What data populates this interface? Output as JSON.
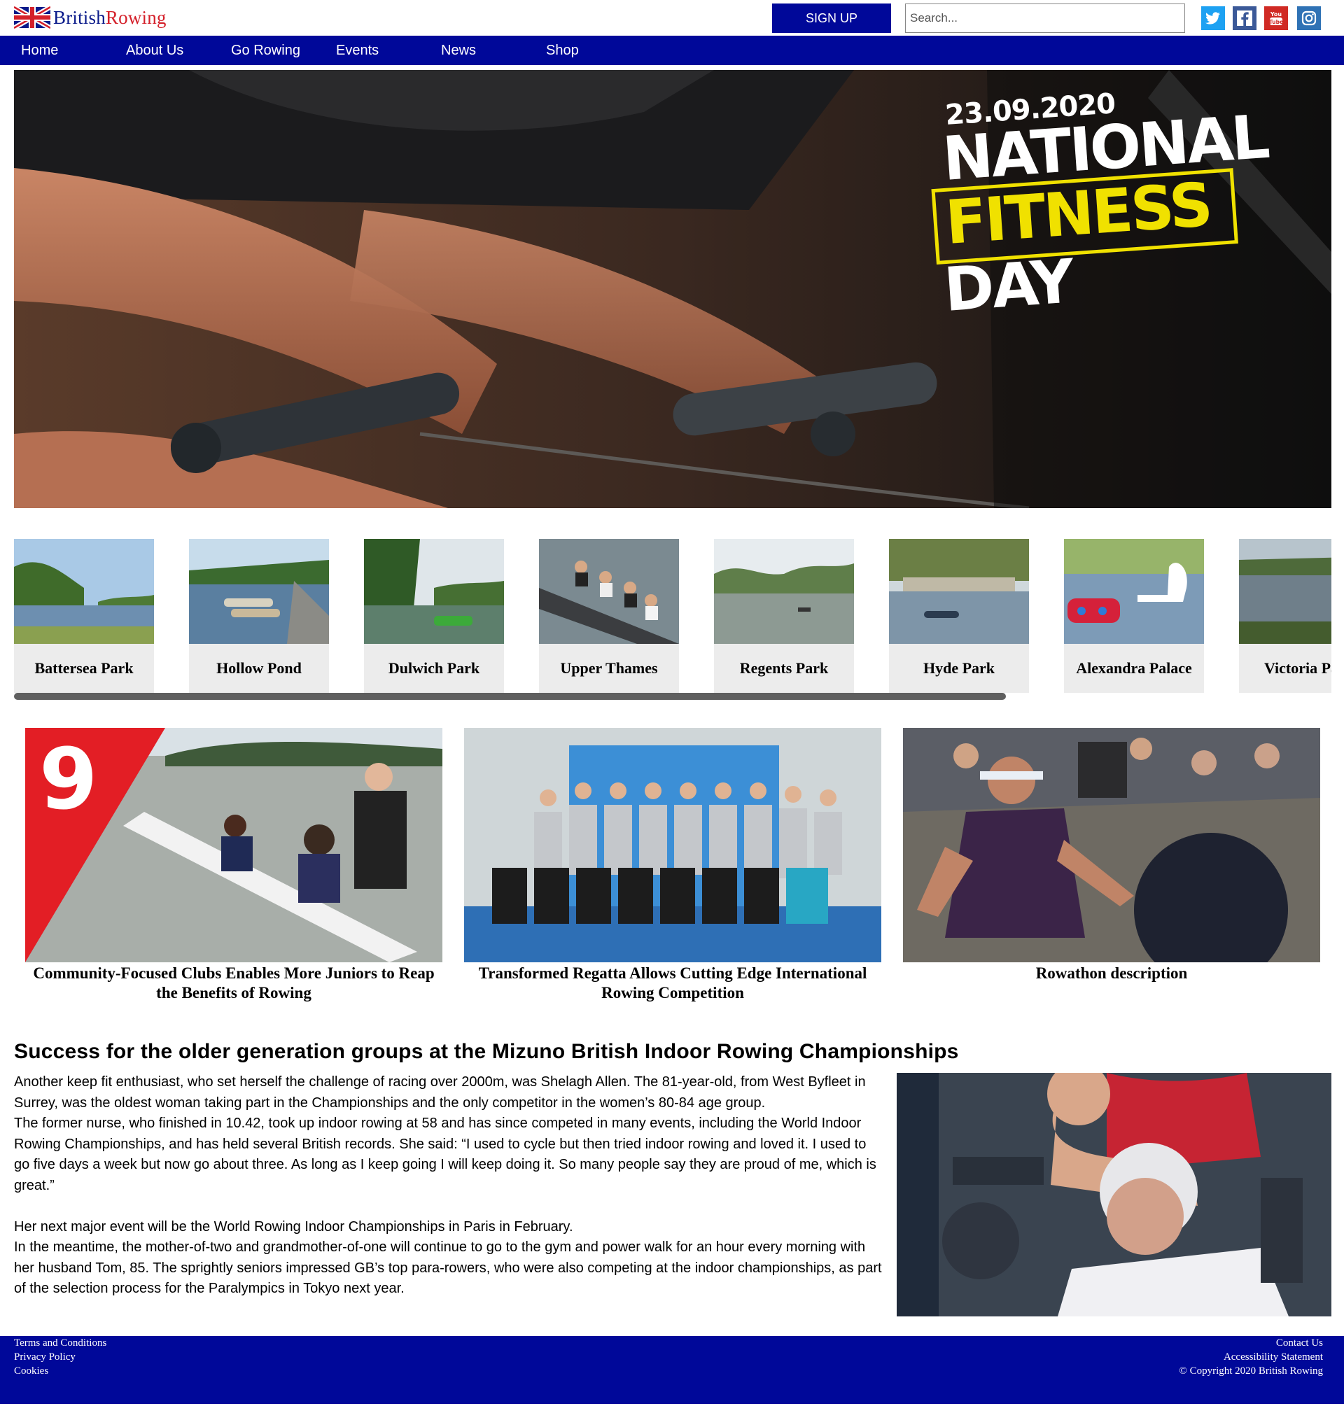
{
  "header": {
    "logo_text_part1": "British",
    "logo_text_part2": "Rowing",
    "signup_label": "SIGN UP",
    "search_placeholder": "Search...",
    "social": [
      {
        "icon": "twitter-icon",
        "color": "#1da1f2"
      },
      {
        "icon": "facebook-icon",
        "color": "#3b5998"
      },
      {
        "icon": "youtube-icon",
        "color": "#d02a24"
      },
      {
        "icon": "instagram-icon",
        "color": "#2f72b5"
      }
    ]
  },
  "nav": {
    "items": [
      "Home",
      "About Us",
      "Go Rowing",
      "Events",
      "News",
      "Shop"
    ]
  },
  "hero": {
    "date": "23.09.2020",
    "line1": "NATIONAL",
    "line2": "FITNESS",
    "line3": "DAY"
  },
  "locations": [
    "Battersea Park",
    "Hollow Pond",
    "Dulwich Park",
    "Upper Thames",
    "Regents Park",
    "Hyde Park",
    "Alexandra Palace",
    "Victoria Park"
  ],
  "news": [
    {
      "title": "Community-Focused Clubs Enables More Juniors to Reap the Benefits of Rowing",
      "badge": "9"
    },
    {
      "title": "Transformed Regatta Allows Cutting Edge International Rowing Competition"
    },
    {
      "title": "Rowathon description"
    }
  ],
  "article": {
    "title": "Success for the older generation groups at the Mizuno British Indoor Rowing Championships",
    "p1": "Another keep fit enthusiast, who set herself the challenge of racing over 2000m, was Shelagh Allen. The 81-year-old, from West Byfleet in Surrey, was the oldest woman taking part in the Championships and the only competitor in the women’s 80-84 age group.",
    "p2": "The former nurse, who finished in 10.42, took up indoor rowing at 58 and has since competed in many events, including the World Indoor Rowing Championships, and has held several British records. She said: “I used to cycle but then tried indoor rowing and loved it. I used to go five days a week but now go about three. As long as I keep going I will keep doing it. So many people say they are proud of me, which is great.”",
    "p3": "Her next major event will be the World Rowing Indoor Championships in Paris in February.",
    "p4": "In the meantime, the mother-of-two and grandmother-of-one will continue to go to the gym and power walk for an hour every morning with her husband Tom, 85. The sprightly seniors impressed GB’s top para-rowers, who were also competing at the indoor championships, as part of the selection process for the Paralympics in Tokyo next year."
  },
  "footer": {
    "left": [
      "Terms and Conditions",
      "Privacy Policy",
      "Cookies"
    ],
    "right": [
      "Contact Us",
      "Accessibility Statement"
    ],
    "copyright": "© Copyright 2020 British Rowing"
  },
  "colors": {
    "brand_blue": "#000899",
    "brand_red": "#d4202a",
    "hero_yellow": "#f0e100"
  }
}
